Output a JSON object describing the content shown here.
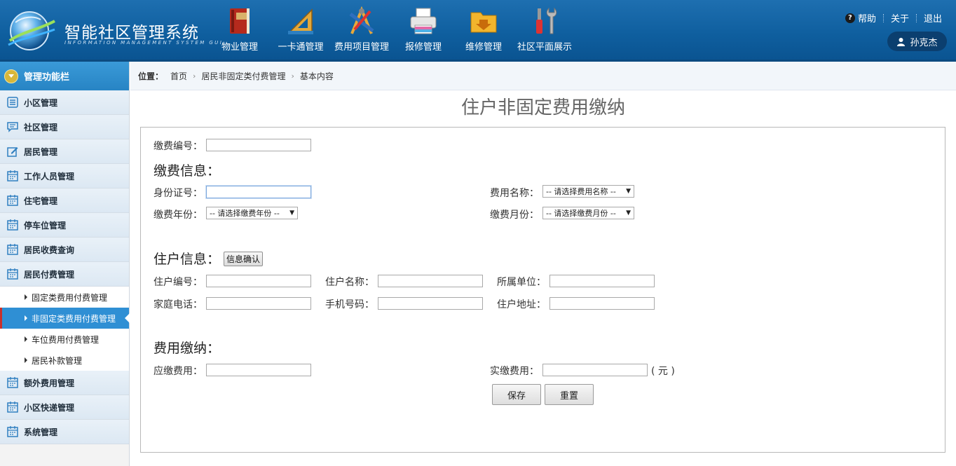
{
  "app": {
    "title": "智能社区管理系统",
    "subtitle": "INFORMATION MANAGEMENT SYSTEM GUI"
  },
  "nav": [
    {
      "label": "物业管理",
      "icon": "book-icon"
    },
    {
      "label": "一卡通管理",
      "icon": "ruler-triangle-icon"
    },
    {
      "label": "费用项目管理",
      "icon": "design-tools-icon"
    },
    {
      "label": "报修管理",
      "icon": "printer-icon"
    },
    {
      "label": "维修管理",
      "icon": "folder-download-icon"
    },
    {
      "label": "社区平面展示",
      "icon": "tools-icon"
    }
  ],
  "top_links": {
    "help": "帮助",
    "about": "关于",
    "logout": "退出"
  },
  "user": {
    "name": "孙克杰"
  },
  "sidebar": {
    "header": "管理功能栏",
    "items": [
      {
        "label": "小区管理",
        "icon": "list-icon"
      },
      {
        "label": "社区管理",
        "icon": "chat-icon"
      },
      {
        "label": "居民管理",
        "icon": "edit-icon"
      },
      {
        "label": "工作人员管理",
        "icon": "calendar-icon"
      },
      {
        "label": "住宅管理",
        "icon": "calendar-icon"
      },
      {
        "label": "停车位管理",
        "icon": "calendar-icon"
      },
      {
        "label": "居民收费查询",
        "icon": "calendar-icon"
      },
      {
        "label": "居民付费管理",
        "icon": "calendar-icon"
      }
    ],
    "sub_items": [
      {
        "label": "固定类费用付费管理",
        "active": false
      },
      {
        "label": "非固定类费用付费管理",
        "active": true
      },
      {
        "label": "车位费用付费管理",
        "active": false
      },
      {
        "label": "居民补款管理",
        "active": false
      }
    ],
    "items_after": [
      {
        "label": "额外费用管理",
        "icon": "calendar-icon"
      },
      {
        "label": "小区快递管理",
        "icon": "calendar-icon"
      },
      {
        "label": "系统管理",
        "icon": "calendar-icon"
      }
    ]
  },
  "breadcrumb": {
    "prefix": "位置：",
    "items": [
      "首页",
      "居民非固定类付费管理",
      "基本内容"
    ],
    "separator": "›"
  },
  "page": {
    "title": "住户非固定费用缴纳"
  },
  "form": {
    "payment_no_label": "缴费编号：",
    "payment_no_value": "",
    "section_payment": "缴费信息：",
    "id_card_label": "身份证号：",
    "id_card_value": "",
    "fee_name_label": "费用名称：",
    "fee_name_selected": "-- 请选择费用名称 --",
    "pay_year_label": "缴费年份：",
    "pay_year_selected": "-- 请选择缴费年份 --",
    "pay_month_label": "缴费月份：",
    "pay_month_selected": "-- 请选择缴费月份 --",
    "section_resident": "住户信息：",
    "confirm_button": "信息确认",
    "resident_no_label": "住户编号：",
    "resident_name_label": "住户名称：",
    "unit_label": "所属单位：",
    "home_phone_label": "家庭电话：",
    "mobile_label": "手机号码：",
    "address_label": "住户地址：",
    "section_fee": "费用缴纳：",
    "due_fee_label": "应缴费用：",
    "paid_fee_label": "实缴费用：",
    "currency_unit": "( 元 )",
    "save_button": "保存",
    "reset_button": "重置"
  },
  "colors": {
    "header_blue": "#0f5f9f",
    "sidebar_active": "#2f8fd4",
    "sidebar_header": "#3a9ad8"
  }
}
